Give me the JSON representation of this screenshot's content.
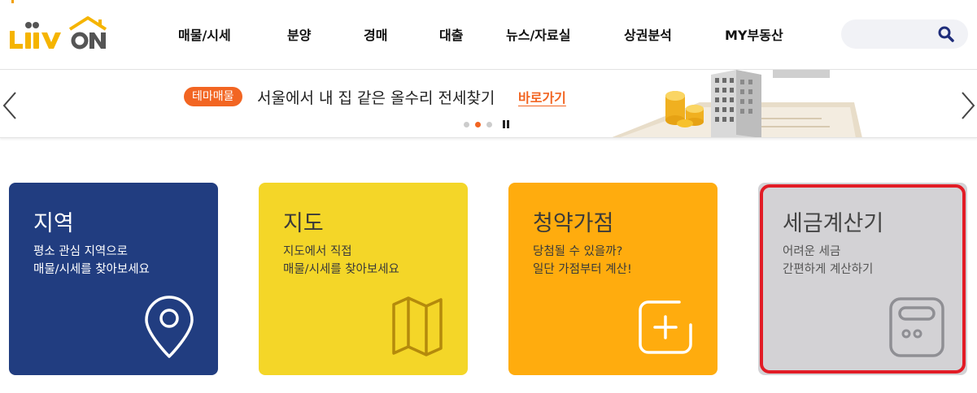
{
  "header": {
    "logo_text": "Liiv ON",
    "nav": [
      {
        "label": "매물/시세"
      },
      {
        "label": "분양"
      },
      {
        "label": "경매"
      },
      {
        "label": "대출"
      },
      {
        "label": "뉴스/자료실"
      },
      {
        "label": "상권분석"
      },
      {
        "label": "MY부동산"
      }
    ],
    "search": {
      "placeholder": "",
      "value": "",
      "icon": "search-icon"
    }
  },
  "banner": {
    "tag": "테마매물",
    "text": "서울에서 내 집 같은 올수리 전세찾기",
    "link": "바로가기",
    "slides": 3,
    "active_slide": 2
  },
  "cards": [
    {
      "title": "지역",
      "desc": [
        "평소 관심 지역으로",
        "매물/시세를 찾아보세요"
      ],
      "icon": "location-pin-icon",
      "color": "#213d80"
    },
    {
      "title": "지도",
      "desc": [
        "지도에서 직접",
        "매물/시세를 찾아보세요"
      ],
      "icon": "map-icon",
      "color": "#f4d628"
    },
    {
      "title": "청약가점",
      "desc": [
        "당첨될 수 있을까?",
        "일단 가점부터 계산!"
      ],
      "icon": "plus-box-icon",
      "color": "#ffac0e"
    },
    {
      "title": "세금계산기",
      "desc": [
        "어려운 세금",
        "간편하게 계산하기"
      ],
      "icon": "calculator-icon",
      "color": "#d3d2d5"
    }
  ],
  "colors": {
    "accent": "#f26522",
    "brand_yellow": "#f2a000",
    "highlight": "#e21c26"
  }
}
